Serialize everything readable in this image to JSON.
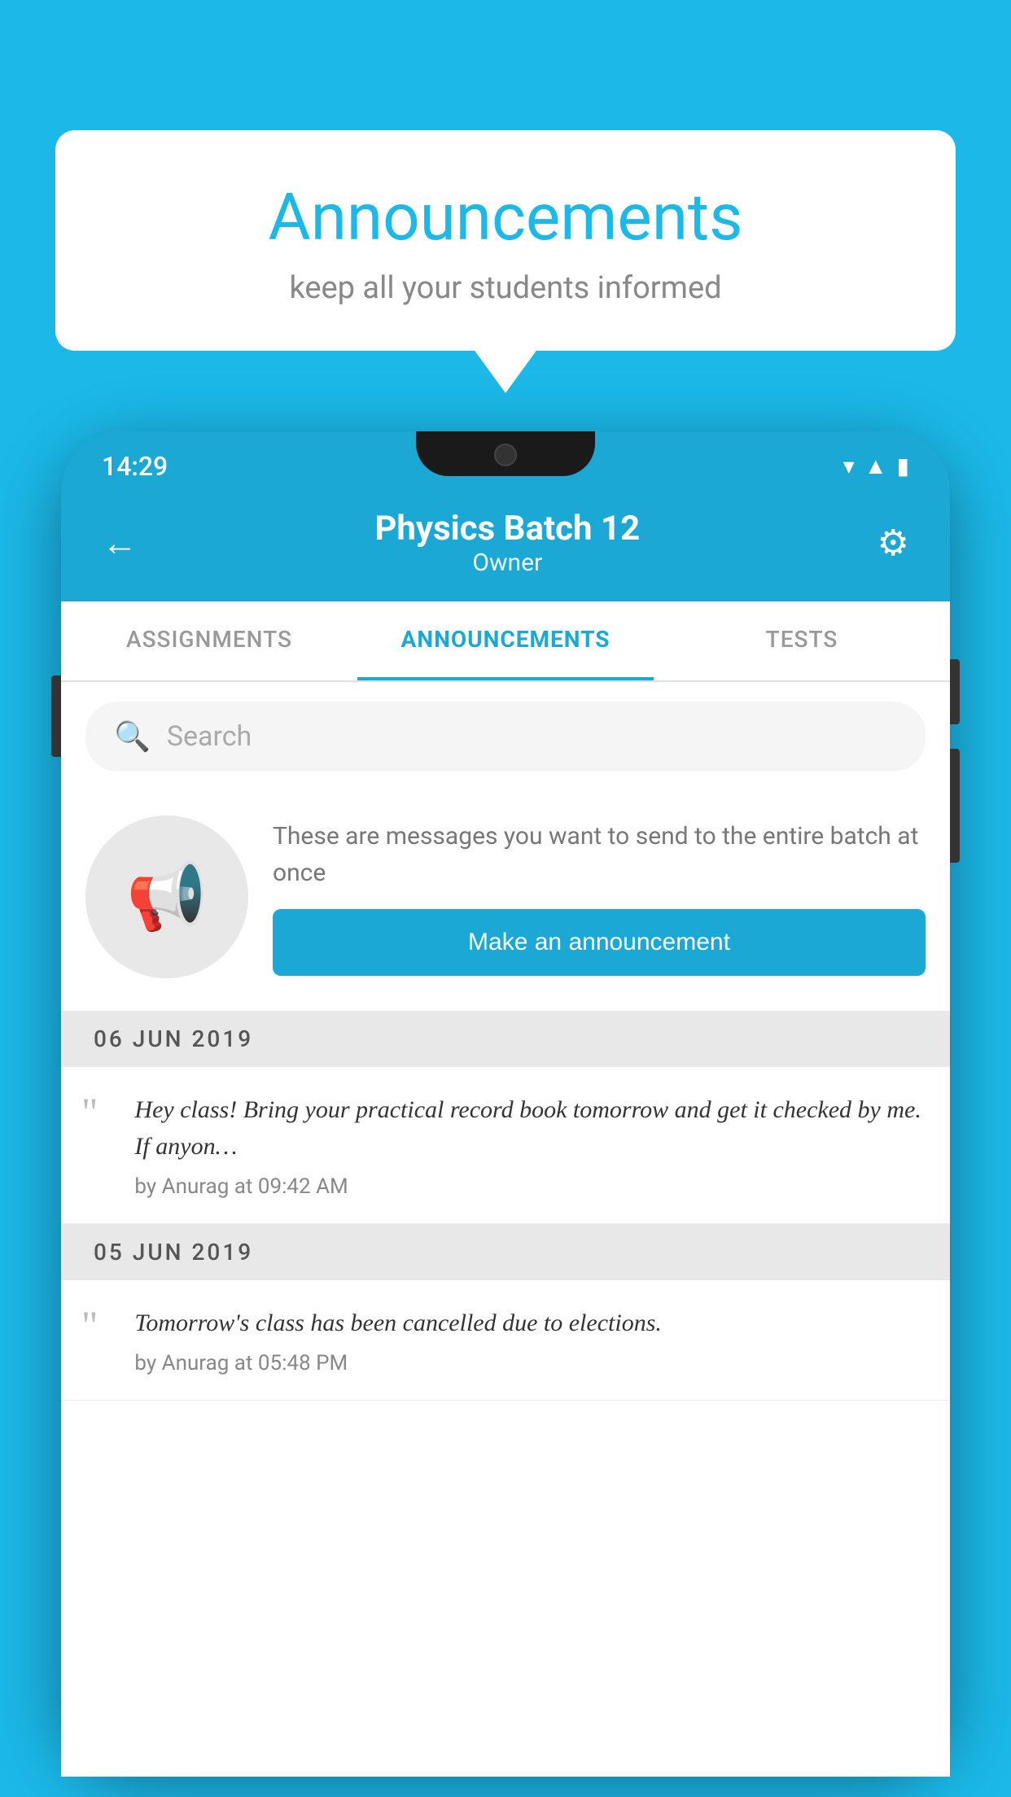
{
  "background": {
    "color": "#1BB8E8"
  },
  "speech_bubble": {
    "title": "Announcements",
    "subtitle": "keep all your students informed"
  },
  "phone": {
    "status_bar": {
      "time": "14:29",
      "wifi": "▾",
      "signal": "▲",
      "battery": "▮"
    },
    "header": {
      "title": "Physics Batch 12",
      "subtitle": "Owner",
      "back_label": "←",
      "settings_label": "⚙"
    },
    "tabs": [
      {
        "label": "ASSIGNMENTS",
        "active": false
      },
      {
        "label": "ANNOUNCEMENTS",
        "active": true
      },
      {
        "label": "TESTS",
        "active": false
      }
    ],
    "search": {
      "placeholder": "Search"
    },
    "announcement_intro": {
      "description": "These are messages you want to send to the entire batch at once",
      "button_label": "Make an announcement"
    },
    "announcements": [
      {
        "date": "06  JUN  2019",
        "message": "Hey class! Bring your practical record book tomorrow and get it checked by me. If anyon…",
        "meta": "by Anurag at 09:42 AM"
      },
      {
        "date": "05  JUN  2019",
        "message": "Tomorrow's class has been cancelled due to elections.",
        "meta": "by Anurag at 05:48 PM"
      }
    ]
  }
}
